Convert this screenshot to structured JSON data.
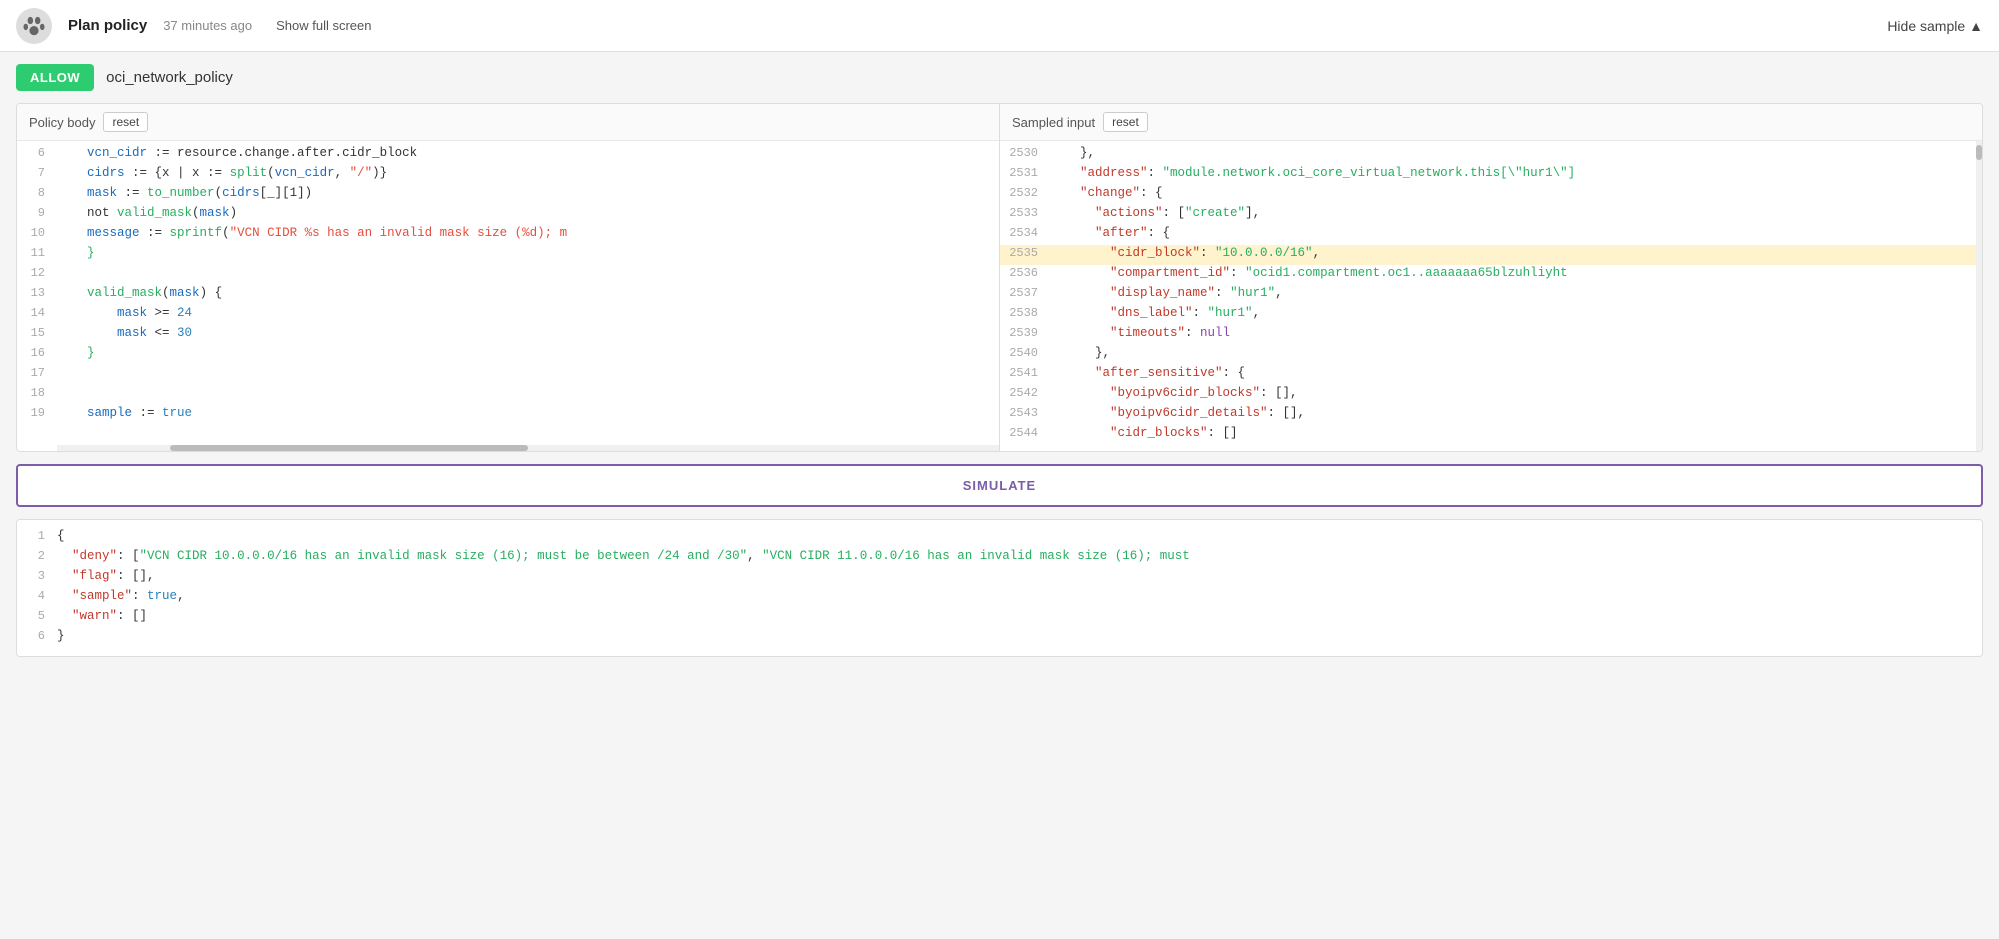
{
  "header": {
    "logo_symbol": "🐾",
    "plan_policy_label": "Plan policy",
    "timestamp": "37 minutes ago",
    "show_fullscreen_label": "Show full screen",
    "hide_sample_label": "Hide sample",
    "chevron_up": "▲"
  },
  "policy": {
    "badge": "ALLOW",
    "name": "oci_network_policy"
  },
  "policy_body": {
    "title": "Policy body",
    "reset_label": "reset",
    "lines": [
      {
        "num": "6",
        "content": "    vcn_cidr := resource.change.after.cidr_block"
      },
      {
        "num": "7",
        "content": "    cidrs := {x | x := split(vcn_cidr, \"/\")}"
      },
      {
        "num": "8",
        "content": "    mask := to_number(cidrs[_][1])"
      },
      {
        "num": "9",
        "content": "    not valid_mask(mask)"
      },
      {
        "num": "10",
        "content": "    message := sprintf(\"VCN CIDR %s has an invalid mask size (%d); m"
      },
      {
        "num": "11",
        "content": "}"
      },
      {
        "num": "12",
        "content": ""
      },
      {
        "num": "13",
        "content": "valid_mask(mask) {"
      },
      {
        "num": "14",
        "content": "    mask >= 24"
      },
      {
        "num": "15",
        "content": "    mask <= 30"
      },
      {
        "num": "16",
        "content": "}"
      },
      {
        "num": "17",
        "content": ""
      },
      {
        "num": "18",
        "content": ""
      },
      {
        "num": "19",
        "content": "sample := true"
      }
    ]
  },
  "sampled_input": {
    "title": "Sampled input",
    "reset_label": "reset",
    "lines": [
      {
        "num": "2530",
        "content": "    },"
      },
      {
        "num": "2531",
        "content": "    \"address\": \"module.network.oci_core_virtual_network.this[\\\"hur1\\\"]"
      },
      {
        "num": "2532",
        "content": "    \"change\": {"
      },
      {
        "num": "2533",
        "content": "      \"actions\": [\"create\"],"
      },
      {
        "num": "2534",
        "content": "      \"after\": {"
      },
      {
        "num": "2535",
        "content": "        \"cidr_block\": \"10.0.0.0/16\","
      },
      {
        "num": "2536",
        "content": "        \"compartment_id\": \"ocid1.compartment.oc1..aaaaaaa65blzuhliyht"
      },
      {
        "num": "2537",
        "content": "        \"display_name\": \"hur1\","
      },
      {
        "num": "2538",
        "content": "        \"dns_label\": \"hur1\","
      },
      {
        "num": "2539",
        "content": "        \"timeouts\": null"
      },
      {
        "num": "2540",
        "content": "      },"
      },
      {
        "num": "2541",
        "content": "      \"after_sensitive\": {"
      },
      {
        "num": "2542",
        "content": "        \"byoipv6cidr_blocks\": [],"
      },
      {
        "num": "2543",
        "content": "        \"byoipv6cidr_details\": [],"
      },
      {
        "num": "2544",
        "content": "        \"cidr_blocks\": []"
      }
    ]
  },
  "simulate_label": "SIMULATE",
  "output": {
    "lines": [
      {
        "num": "1",
        "content": "{"
      },
      {
        "num": "2",
        "content": "  \"deny\": [\"VCN CIDR 10.0.0.0/16 has an invalid mask size (16); must be between /24 and /30\", \"VCN CIDR 11.0.0.0/16 has an invalid mask size (16); must"
      },
      {
        "num": "3",
        "content": "  \"flag\": [],"
      },
      {
        "num": "4",
        "content": "  \"sample\": true,"
      },
      {
        "num": "5",
        "content": "  \"warn\": []"
      },
      {
        "num": "6",
        "content": "}"
      }
    ]
  }
}
